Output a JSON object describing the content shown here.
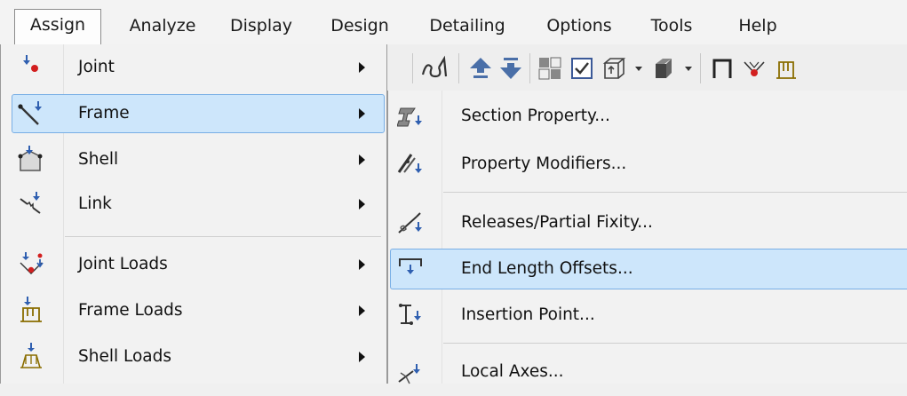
{
  "menubar": {
    "items": [
      {
        "label": "Assign",
        "active": true
      },
      {
        "label": "Analyze"
      },
      {
        "label": "Display"
      },
      {
        "label": "Design"
      },
      {
        "label": "Detailing"
      },
      {
        "label": "Options"
      },
      {
        "label": "Tools"
      },
      {
        "label": "Help"
      }
    ]
  },
  "assign_menu": {
    "items": [
      {
        "label": "Joint",
        "icon": "joint-icon",
        "submenu": true
      },
      {
        "label": "Frame",
        "icon": "frame-icon",
        "submenu": true,
        "highlighted": true
      },
      {
        "label": "Shell",
        "icon": "shell-icon",
        "submenu": true
      },
      {
        "label": "Link",
        "icon": "link-icon",
        "submenu": true
      },
      {
        "label": "Joint Loads",
        "icon": "joint-loads-icon",
        "submenu": true
      },
      {
        "label": "Frame Loads",
        "icon": "frame-loads-icon",
        "submenu": true
      },
      {
        "label": "Shell Loads",
        "icon": "shell-loads-icon",
        "submenu": true
      }
    ]
  },
  "frame_submenu": {
    "items": [
      {
        "label": "Section Property...",
        "icon": "section-property-icon"
      },
      {
        "label": "Property Modifiers...",
        "icon": "property-modifiers-icon"
      },
      {
        "label": "Releases/Partial Fixity...",
        "icon": "releases-icon"
      },
      {
        "label": "End Length Offsets...",
        "icon": "end-length-offsets-icon",
        "highlighted": true
      },
      {
        "label": "Insertion Point...",
        "icon": "insertion-point-icon"
      },
      {
        "label": "Local Axes...",
        "icon": "local-axes-icon"
      }
    ]
  },
  "colors": {
    "highlight_fill": "#cde6fb",
    "highlight_border": "#78aee5",
    "joint_red": "#d21f1f",
    "arrow_blue": "#2f5fb0"
  }
}
